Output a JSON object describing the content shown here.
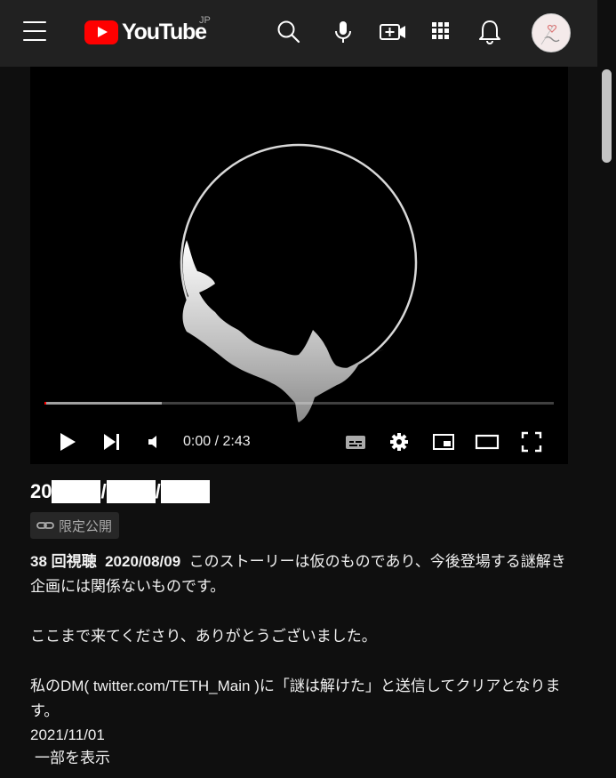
{
  "header": {
    "logo_text": "YouTube",
    "region": "JP",
    "icons": [
      "menu-icon",
      "search-icon",
      "microphone-icon",
      "create-video-icon",
      "apps-icon",
      "notifications-icon"
    ]
  },
  "player": {
    "time_display": "0:00 / 2:43",
    "progress_fraction": 0.0,
    "buffered_fraction": 0.23
  },
  "video": {
    "title_prefix": "20",
    "title_sep1": "/",
    "title_sep2": "/",
    "visibility_badge": "限定公開"
  },
  "description": {
    "views": "38 回視聴",
    "date": "2020/08/09",
    "line1": "このストーリーは仮のものであり、今後登場する謎解き企画には関係ないものです。",
    "line2": "ここまで来てくださり、ありがとうございました。",
    "line3": "私のDM( twitter.com/TETH_Main )に「謎は解けた」と送信してクリアとなります。",
    "line4": "2021/11/01",
    "show_more": "一部を表示"
  },
  "colors": {
    "accent": "#ff0000",
    "background": "#0f0f0f",
    "header_bg": "#212121"
  }
}
